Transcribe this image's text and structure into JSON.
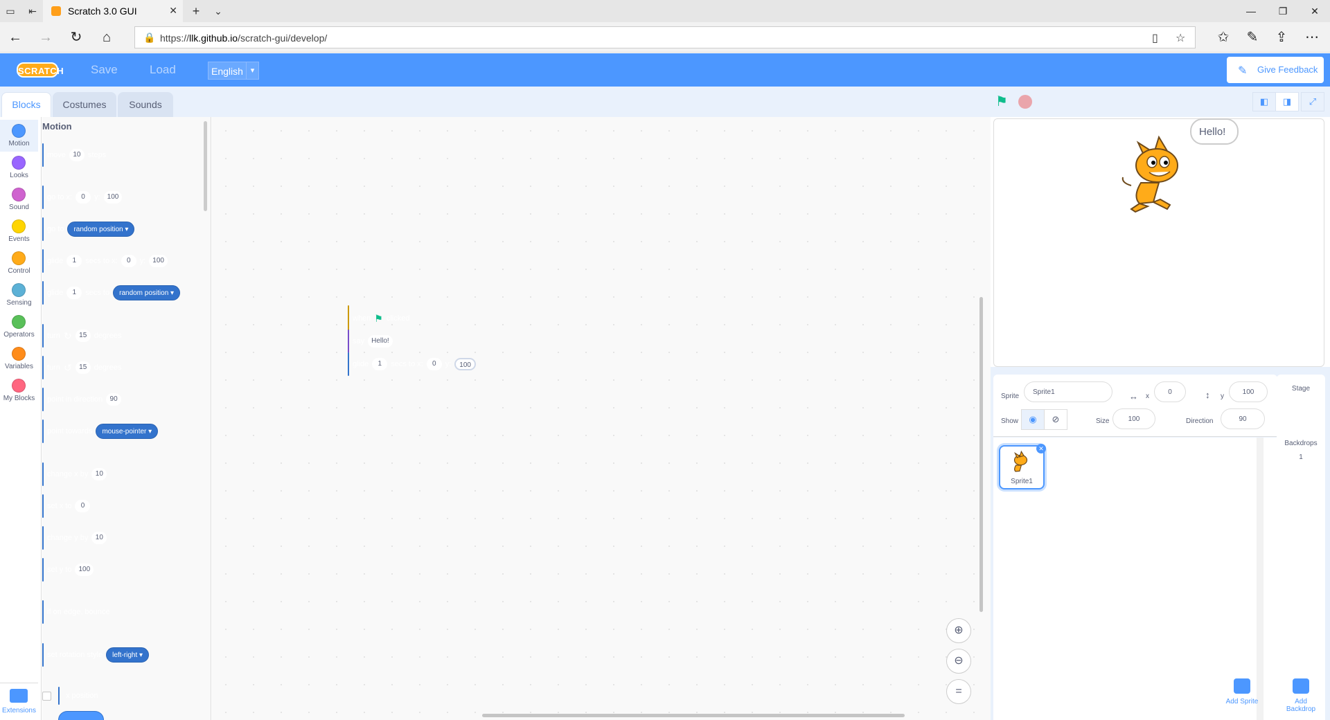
{
  "browser": {
    "tab_title": "Scratch 3.0 GUI",
    "url_prefix": "https://",
    "url_host": "llk.github.io",
    "url_path": "/scratch-gui/develop/"
  },
  "menubar": {
    "logo": "SCRATCH",
    "save": "Save",
    "load": "Load",
    "language": "English",
    "feedback": "Give Feedback"
  },
  "tabs": [
    "Blocks",
    "Costumes",
    "Sounds"
  ],
  "categories": [
    {
      "label": "Motion",
      "color": "#4c97ff"
    },
    {
      "label": "Looks",
      "color": "#9966ff"
    },
    {
      "label": "Sound",
      "color": "#cf63cf"
    },
    {
      "label": "Events",
      "color": "#ffd500"
    },
    {
      "label": "Control",
      "color": "#ffab19"
    },
    {
      "label": "Sensing",
      "color": "#5cb1d6"
    },
    {
      "label": "Operators",
      "color": "#59c059"
    },
    {
      "label": "Variables",
      "color": "#ff8c1a"
    },
    {
      "label": "My Blocks",
      "color": "#ff6680"
    }
  ],
  "extensions_label": "Extensions",
  "palette": {
    "title": "Motion",
    "move": {
      "a": "move",
      "v": "10",
      "b": "steps"
    },
    "goto_xy": {
      "a": "go to x:",
      "x": "0",
      "b": "y:",
      "y": "100"
    },
    "goto": {
      "a": "go to",
      "dd": "random position ▾"
    },
    "glide_xy": {
      "a": "glide",
      "s": "1",
      "b": "secs to x:",
      "x": "0",
      "c": "y:",
      "y": "100"
    },
    "glide_to": {
      "a": "glide",
      "s": "1",
      "b": "secs to",
      "dd": "random position ▾"
    },
    "turn_right": {
      "a": "turn",
      "icon": "↻",
      "v": "15",
      "b": "degrees"
    },
    "turn_left": {
      "a": "turn",
      "icon": "↺",
      "v": "15",
      "b": "degrees"
    },
    "point_dir": {
      "a": "point in direction",
      "v": "90"
    },
    "point_towards": {
      "a": "point towards",
      "dd": "mouse-pointer ▾"
    },
    "change_x": {
      "a": "change x by",
      "v": "10"
    },
    "set_x": {
      "a": "set x to",
      "v": "0"
    },
    "change_y": {
      "a": "change y by",
      "v": "10"
    },
    "set_y": {
      "a": "set y to",
      "v": "100"
    },
    "bounce": {
      "a": "if on edge, bounce"
    },
    "rotation": {
      "a": "set rotation style",
      "dd": "left-right ▾"
    },
    "x_position": "x position"
  },
  "script": {
    "hat": {
      "a": "when",
      "b": "clicked"
    },
    "say": {
      "a": "say",
      "v": "Hello!"
    },
    "glide": {
      "a": "glide",
      "s": "1",
      "b": "secs to x:",
      "x": "0",
      "c": "y:",
      "y": "100"
    }
  },
  "stage": {
    "bubble": "Hello!"
  },
  "sprite_info": {
    "sprite_label": "Sprite",
    "sprite_name": "Sprite1",
    "x_label": "x",
    "x": "0",
    "y_label": "y",
    "y": "100",
    "show_label": "Show",
    "size_label": "Size",
    "size": "100",
    "direction_label": "Direction",
    "direction": "90"
  },
  "sprites": [
    {
      "name": "Sprite1"
    }
  ],
  "add_sprite": "Add Sprite",
  "stage_target": {
    "title": "Stage",
    "backdrops_label": "Backdrops",
    "backdrops_count": "1",
    "add_backdrop": "Add Backdrop"
  }
}
